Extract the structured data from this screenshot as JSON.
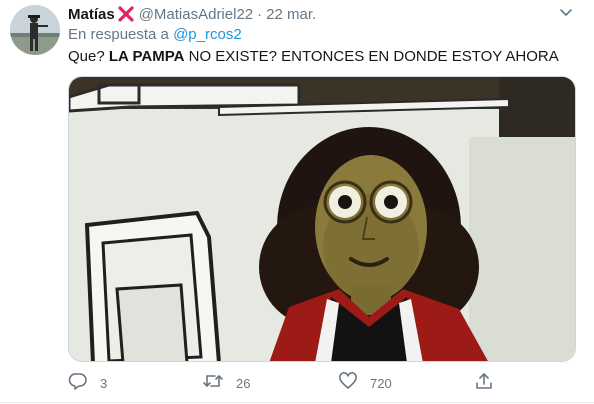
{
  "tweet": {
    "name": "Matías",
    "handle": "@MatiasAdriel22",
    "separator": "·",
    "date": "22 mar.",
    "reply_prefix": "En respuesta a",
    "reply_user": "@p_rcos2",
    "text_part1": "Que? ",
    "text_bold": "LA PAMPA",
    "text_part2": " NO EXISTE? ENTONCES EN DONDE ESTOY AHORA"
  },
  "actions": {
    "reply_count": "3",
    "retweet_count": "26",
    "like_count": "720"
  },
  "icons": {
    "name_badge": "red-cross-mark-icon",
    "more": "chevron-down-icon",
    "reply": "reply-icon",
    "retweet": "retweet-icon",
    "like": "heart-icon",
    "share": "share-icon"
  },
  "colors": {
    "link": "#1b95e0",
    "secondary_text": "#657786",
    "primary_text": "#14171a",
    "badge_red": "#e0245e"
  }
}
